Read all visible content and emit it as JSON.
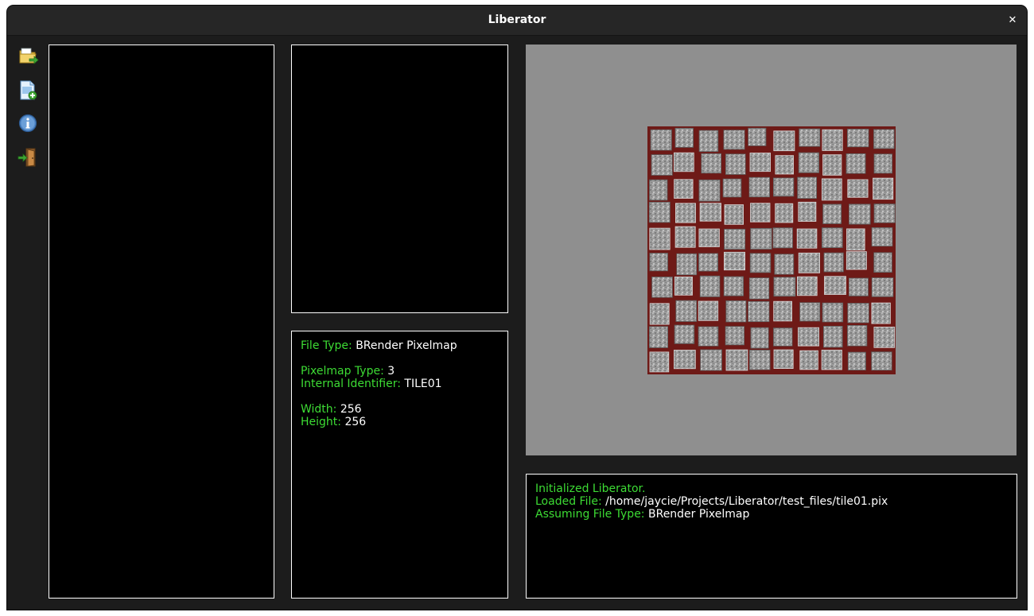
{
  "window": {
    "title": "Liberator",
    "close_glyph": "✕"
  },
  "toolbar": {
    "tools": [
      {
        "name": "open-folder-icon"
      },
      {
        "name": "new-file-icon"
      },
      {
        "name": "info-icon"
      },
      {
        "name": "exit-door-icon"
      }
    ]
  },
  "info": {
    "file_type_label": "File Type:",
    "file_type_value": "BRender Pixelmap",
    "pixelmap_type_label": "Pixelmap Type:",
    "pixelmap_type_value": "3",
    "internal_id_label": "Internal Identifier:",
    "internal_id_value": "TILE01",
    "width_label": "Width:",
    "width_value": "256",
    "height_label": "Height:",
    "height_value": "256"
  },
  "log": {
    "line1": "Initialized Liberator.",
    "loaded_label": "Loaded File:",
    "loaded_value": "/home/jaycie/Projects/Liberator/test_files/tile01.pix",
    "assuming_label": "Assuming File Type:",
    "assuming_value": "BRender Pixelmap"
  },
  "colors": {
    "label_green": "#3ddc34",
    "window_bg": "#1c1c1c",
    "preview_bg": "#8f8f8f",
    "tile_grout": "#6e1a17"
  }
}
